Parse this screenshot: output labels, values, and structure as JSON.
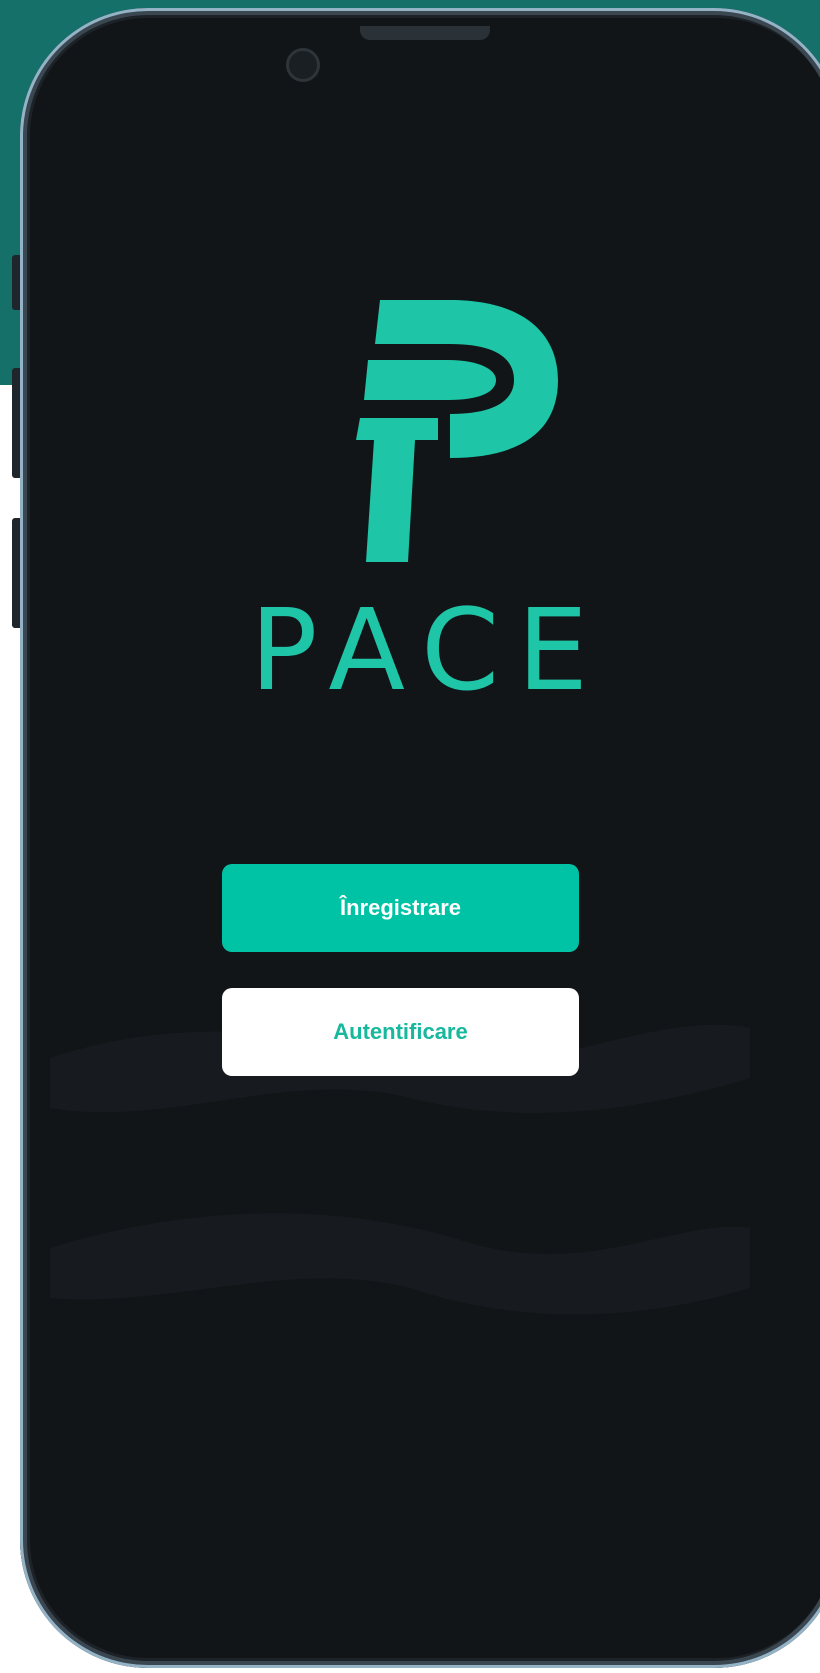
{
  "app": {
    "brand_name": "PACE",
    "accent_color": "#00c2a4",
    "background_color": "#121518"
  },
  "actions": {
    "register_label": "Înregistrare",
    "login_label": "Autentificare"
  },
  "icons": {
    "logo": "pace-p-logo-icon",
    "camera": "front-camera-icon"
  }
}
